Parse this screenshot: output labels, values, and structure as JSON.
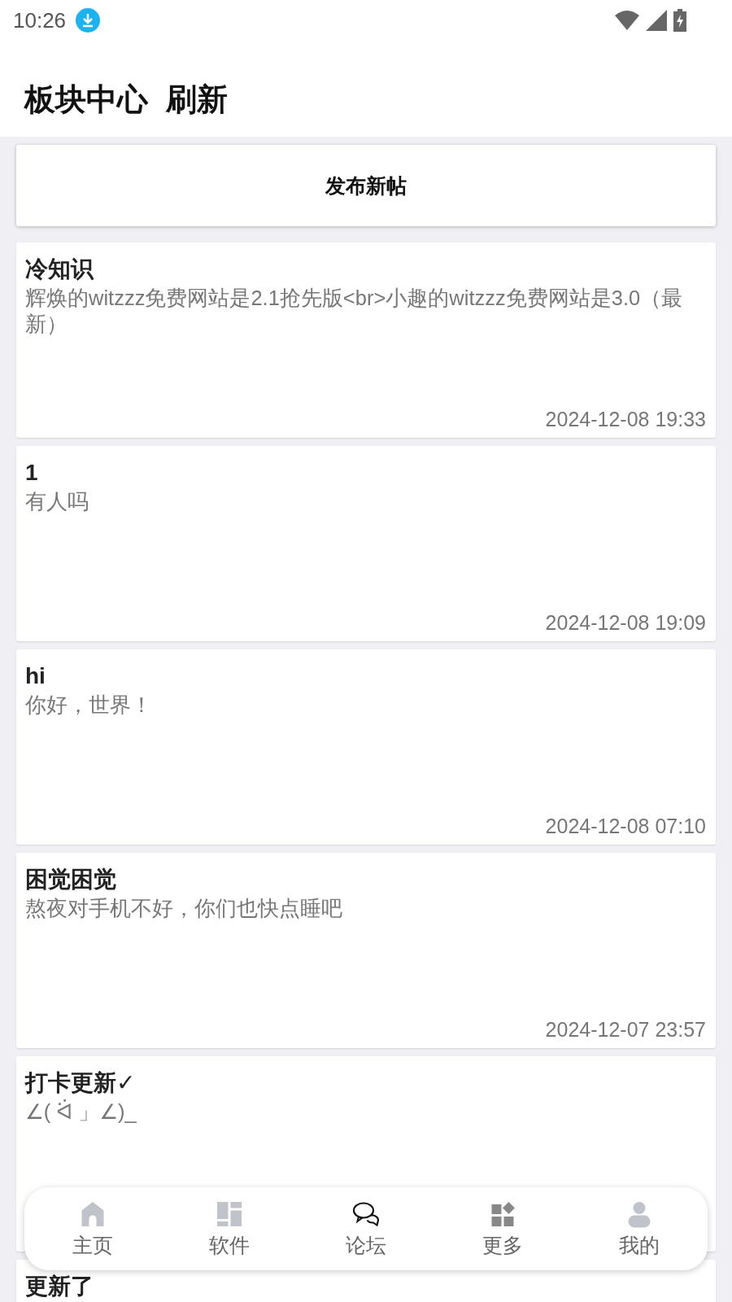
{
  "status_bar": {
    "time": "10:26"
  },
  "header": {
    "title": "板块中心",
    "action": "刷新"
  },
  "new_post_button": "发布新帖",
  "posts": [
    {
      "title": "冷知识",
      "body": "辉焕的witzzz免费网站是2.1抢先版<br>小趣的witzzz免费网站是3.0（最新）",
      "date": "2024-12-08 19:33"
    },
    {
      "title": "1",
      "body": "有人吗",
      "date": "2024-12-08 19:09"
    },
    {
      "title": "hi",
      "body": "你好，世界！",
      "date": "2024-12-08 07:10"
    },
    {
      "title": "困觉困觉",
      "body": "熬夜对手机不好，你们也快点睡吧",
      "date": "2024-12-07 23:57"
    },
    {
      "title": "打卡更新✓",
      "body": "∠( ᐛ 」∠)_"
    },
    {
      "title": "更新了"
    }
  ],
  "nav": [
    {
      "kind": "home",
      "label": "主页",
      "selected": false
    },
    {
      "kind": "apps",
      "label": "软件",
      "selected": false
    },
    {
      "kind": "forum",
      "label": "论坛",
      "selected": true
    },
    {
      "kind": "more",
      "label": "更多",
      "selected": false
    },
    {
      "kind": "me",
      "label": "我的",
      "selected": false
    }
  ]
}
